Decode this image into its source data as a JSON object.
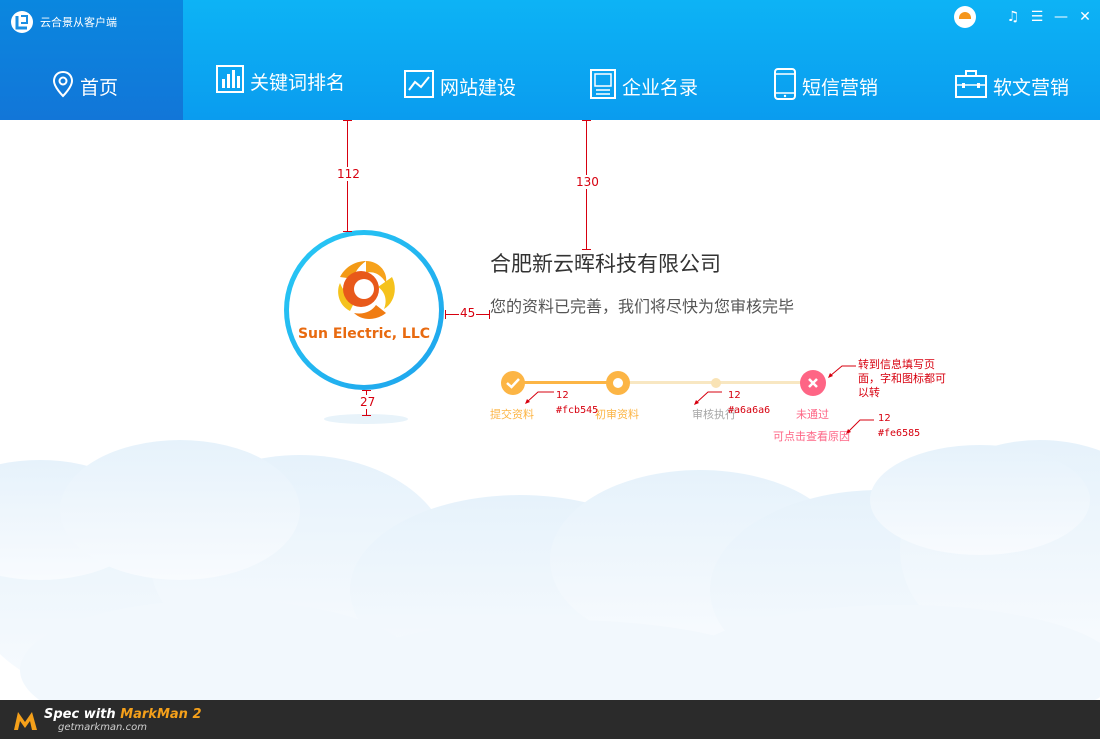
{
  "app": {
    "title": "云合景从客户端"
  },
  "window_controls": {
    "headset": "♫",
    "menu": "☰",
    "minimize": "—",
    "close": "✕"
  },
  "nav": {
    "items": [
      {
        "label": "首页",
        "icon": "location-pin-icon",
        "active": true
      },
      {
        "label": "关键词排名",
        "icon": "bar-chart-icon"
      },
      {
        "label": "网站建设",
        "icon": "line-chart-icon"
      },
      {
        "label": "企业名录",
        "icon": "book-icon"
      },
      {
        "label": "短信营销",
        "icon": "phone-icon"
      },
      {
        "label": "软文营销",
        "icon": "briefcase-icon"
      }
    ]
  },
  "company": {
    "logo_text": "Sun Electric, LLC",
    "name": "合肥新云晖科技有限公司",
    "status": "您的资料已完善，我们将尽快为您审核完毕"
  },
  "steps": [
    {
      "label": "提交资料",
      "state": "done",
      "color": "#fcb545"
    },
    {
      "label": "初审资料",
      "state": "current",
      "color": "#fcb545"
    },
    {
      "label": "审核执行",
      "state": "pending",
      "color": "#a6a6a6"
    },
    {
      "label": "未通过",
      "state": "failed",
      "color": "#fe6585"
    }
  ],
  "failed_hint": "可点击查看原因",
  "annotations": {
    "dist_top_logo": "112",
    "dist_top_name": "130",
    "dist_logo_name": "45",
    "dist_logo_shadow": "27",
    "size_step_done": "12",
    "color_step_done": "#fcb545",
    "size_step_pending": "12",
    "color_step_pending": "#a6a6a6",
    "size_step_failed": "12",
    "color_step_failed": "#fe6585",
    "note_failed": "转到信息填写页面，字和图标都可以转"
  },
  "footer": {
    "spec_prefix": "Spec with",
    "spec_brand": "MarkMan 2",
    "site": "getmarkman.com"
  },
  "colors": {
    "header": "#0a9cef",
    "header_active": "#1276d8",
    "step_done": "#fcb545",
    "step_pending": "#a6a6a6",
    "step_failed": "#fe6585",
    "annotation": "#d7000f"
  }
}
